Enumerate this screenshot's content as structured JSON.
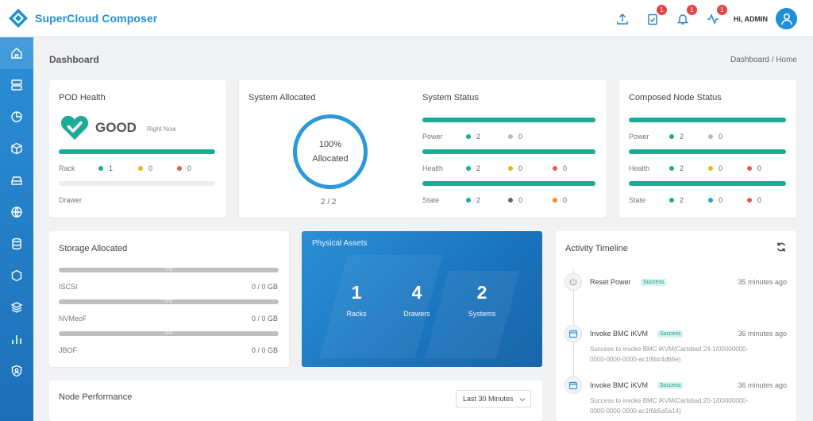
{
  "app": {
    "title": "SuperCloud Composer",
    "greeting": "Hi, ADMIN"
  },
  "top_icons": [
    {
      "name": "upload-icon",
      "badge": ""
    },
    {
      "name": "clipboard-check-icon",
      "badge": "1"
    },
    {
      "name": "bell-icon",
      "badge": "1"
    },
    {
      "name": "activity-icon",
      "badge": "1"
    }
  ],
  "sidebar": {
    "items": [
      "home-icon",
      "server-icon",
      "pie-chart-icon",
      "box-icon",
      "drive-icon",
      "globe-icon",
      "database-icon",
      "hexagon-icon",
      "layers-icon",
      "bar-chart-icon",
      "shield-user-icon"
    ]
  },
  "page": {
    "title": "Dashboard",
    "breadcrumb": "Dashboard / Home"
  },
  "pod_health": {
    "title": "POD Health",
    "status": "GOOD",
    "status_sub": "Right Now",
    "rack_label": "Rack",
    "rack_values": [
      "1",
      "0",
      "0"
    ],
    "drawer_label": "Drawer"
  },
  "system_allocated": {
    "title": "System Allocated",
    "percent": "100%",
    "label": "Allocated",
    "fraction": "2 / 2"
  },
  "system_status": {
    "title": "System Status",
    "rows": [
      {
        "label": "Power",
        "values": [
          "2",
          "0"
        ]
      },
      {
        "label": "Health",
        "values": [
          "2",
          "0",
          "0"
        ]
      },
      {
        "label": "State",
        "values": [
          "2",
          "0",
          "0"
        ]
      }
    ]
  },
  "composed_node_status": {
    "title": "Composed Node Status",
    "rows": [
      {
        "label": "Power",
        "values": [
          "2",
          "0"
        ]
      },
      {
        "label": "Health",
        "values": [
          "2",
          "0",
          "0"
        ]
      },
      {
        "label": "State",
        "values": [
          "2",
          "0",
          "0"
        ]
      }
    ]
  },
  "storage_allocated": {
    "title": "Storage Allocated",
    "items": [
      {
        "name": "ISCSI",
        "value": "0 / 0 GB",
        "bar_label": "0 %"
      },
      {
        "name": "NVMeoF",
        "value": "0 / 0 GB",
        "bar_label": "0 %"
      },
      {
        "name": "JBOF",
        "value": "0 / 0 GB",
        "bar_label": "0 %"
      }
    ]
  },
  "physical_assets": {
    "title": "Physical Assets",
    "items": [
      {
        "count": "1",
        "label": "Racks"
      },
      {
        "count": "4",
        "label": "Drawers"
      },
      {
        "count": "2",
        "label": "Systems"
      }
    ]
  },
  "activity_timeline": {
    "title": "Activity Timeline",
    "events": [
      {
        "title": "Reset Power",
        "status": "Success",
        "time": "35 minutes ago",
        "desc": ""
      },
      {
        "title": "Invoke BMC iKVM",
        "status": "Success",
        "time": "36 minutes ago",
        "desc": "Success to invoke BMC iKVM(Carlsbad:24-1/00000000-0000-0000-0000-ac1f6bc4d66e)"
      },
      {
        "title": "Invoke BMC iKVM",
        "status": "Success",
        "time": "36 minutes ago",
        "desc": "Success to invoke BMC iKVM(Carlsbad:20-1/00000000-0000-0000-0000-ac1f6b5a5a14)"
      }
    ]
  },
  "node_performance": {
    "title": "Node Performance",
    "range": "Last 30 Minutes"
  },
  "colors": {
    "accent": "#1f8fd6",
    "good": "#1bab97",
    "warn": "#f2b01e",
    "error": "#e05a5a",
    "neutral": "#bbbbbb",
    "blue": "#2c9ad8",
    "state_dark": "#666666",
    "state_orange": "#f08c2a"
  }
}
